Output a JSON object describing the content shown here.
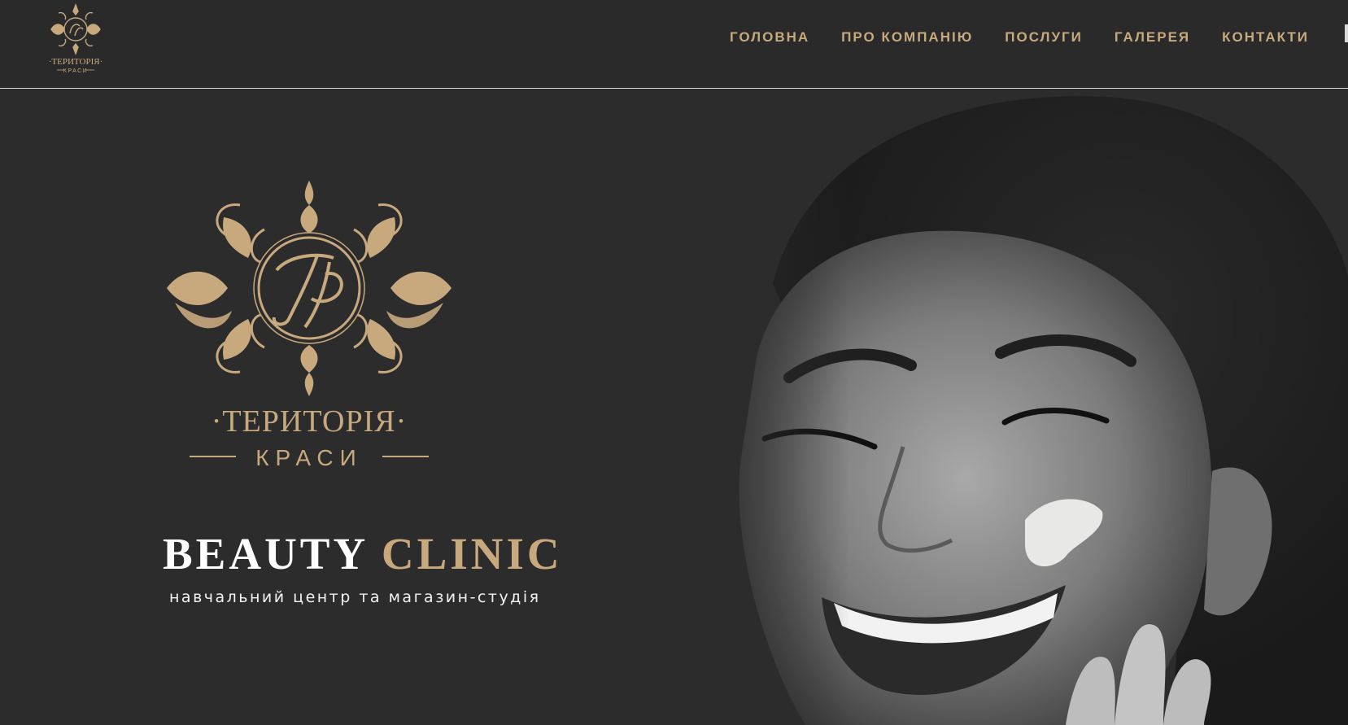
{
  "colors": {
    "background": "#2b2b2c",
    "gold": "#c8a97e",
    "white": "#ffffff",
    "divider": "#d9d9d9"
  },
  "logo": {
    "monogram": "ТК",
    "name_line1": "·ТЕРИТОРІЯ·",
    "name_line2": "КРАСИ"
  },
  "nav": {
    "items": [
      {
        "label": "ГОЛОВНА"
      },
      {
        "label": "ПРО КОМПАНІЮ"
      },
      {
        "label": "ПОСЛУГИ"
      },
      {
        "label": "ГАЛЕРЕЯ"
      },
      {
        "label": "КОНТАКТИ"
      }
    ]
  },
  "hero": {
    "title_part1": "BEAUTY",
    "title_part2": "CLINIC",
    "tagline": "навчальний центр та магазин-студія",
    "photo": "woman-smiling-with-cream-on-cheek"
  }
}
